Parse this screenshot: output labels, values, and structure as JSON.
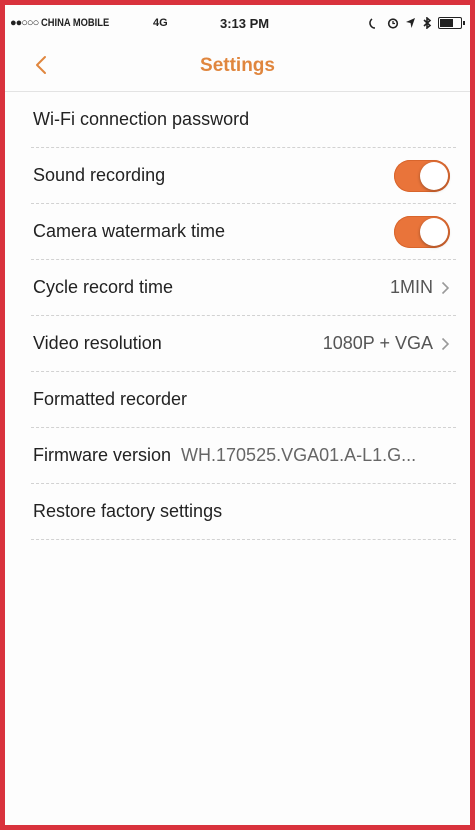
{
  "status_bar": {
    "signal": "●●○○○",
    "carrier": "CHINA MOBILE",
    "network": "4G",
    "time": "3:13 PM",
    "icons": [
      "rotation-lock-icon",
      "alarm-icon",
      "location-icon",
      "bluetooth-icon",
      "battery-icon"
    ]
  },
  "header": {
    "title": "Settings",
    "back_icon": "chevron-left-icon",
    "accent_color": "#e0863e"
  },
  "settings": {
    "wifi_password": {
      "label": "Wi-Fi connection password"
    },
    "sound_recording": {
      "label": "Sound recording",
      "enabled": true
    },
    "watermark_time": {
      "label": "Camera watermark time",
      "enabled": true
    },
    "cycle_record": {
      "label": "Cycle record time",
      "value": "1MIN"
    },
    "video_resolution": {
      "label": "Video resolution",
      "value": "1080P + VGA"
    },
    "format_recorder": {
      "label": "Formatted recorder"
    },
    "firmware": {
      "label": "Firmware version",
      "value": "WH.170525.VGA01.A-L1.G..."
    },
    "restore_factory": {
      "label": "Restore factory settings"
    }
  },
  "colors": {
    "toggle_on": "#e9743a",
    "frame_border": "#d9323d"
  }
}
